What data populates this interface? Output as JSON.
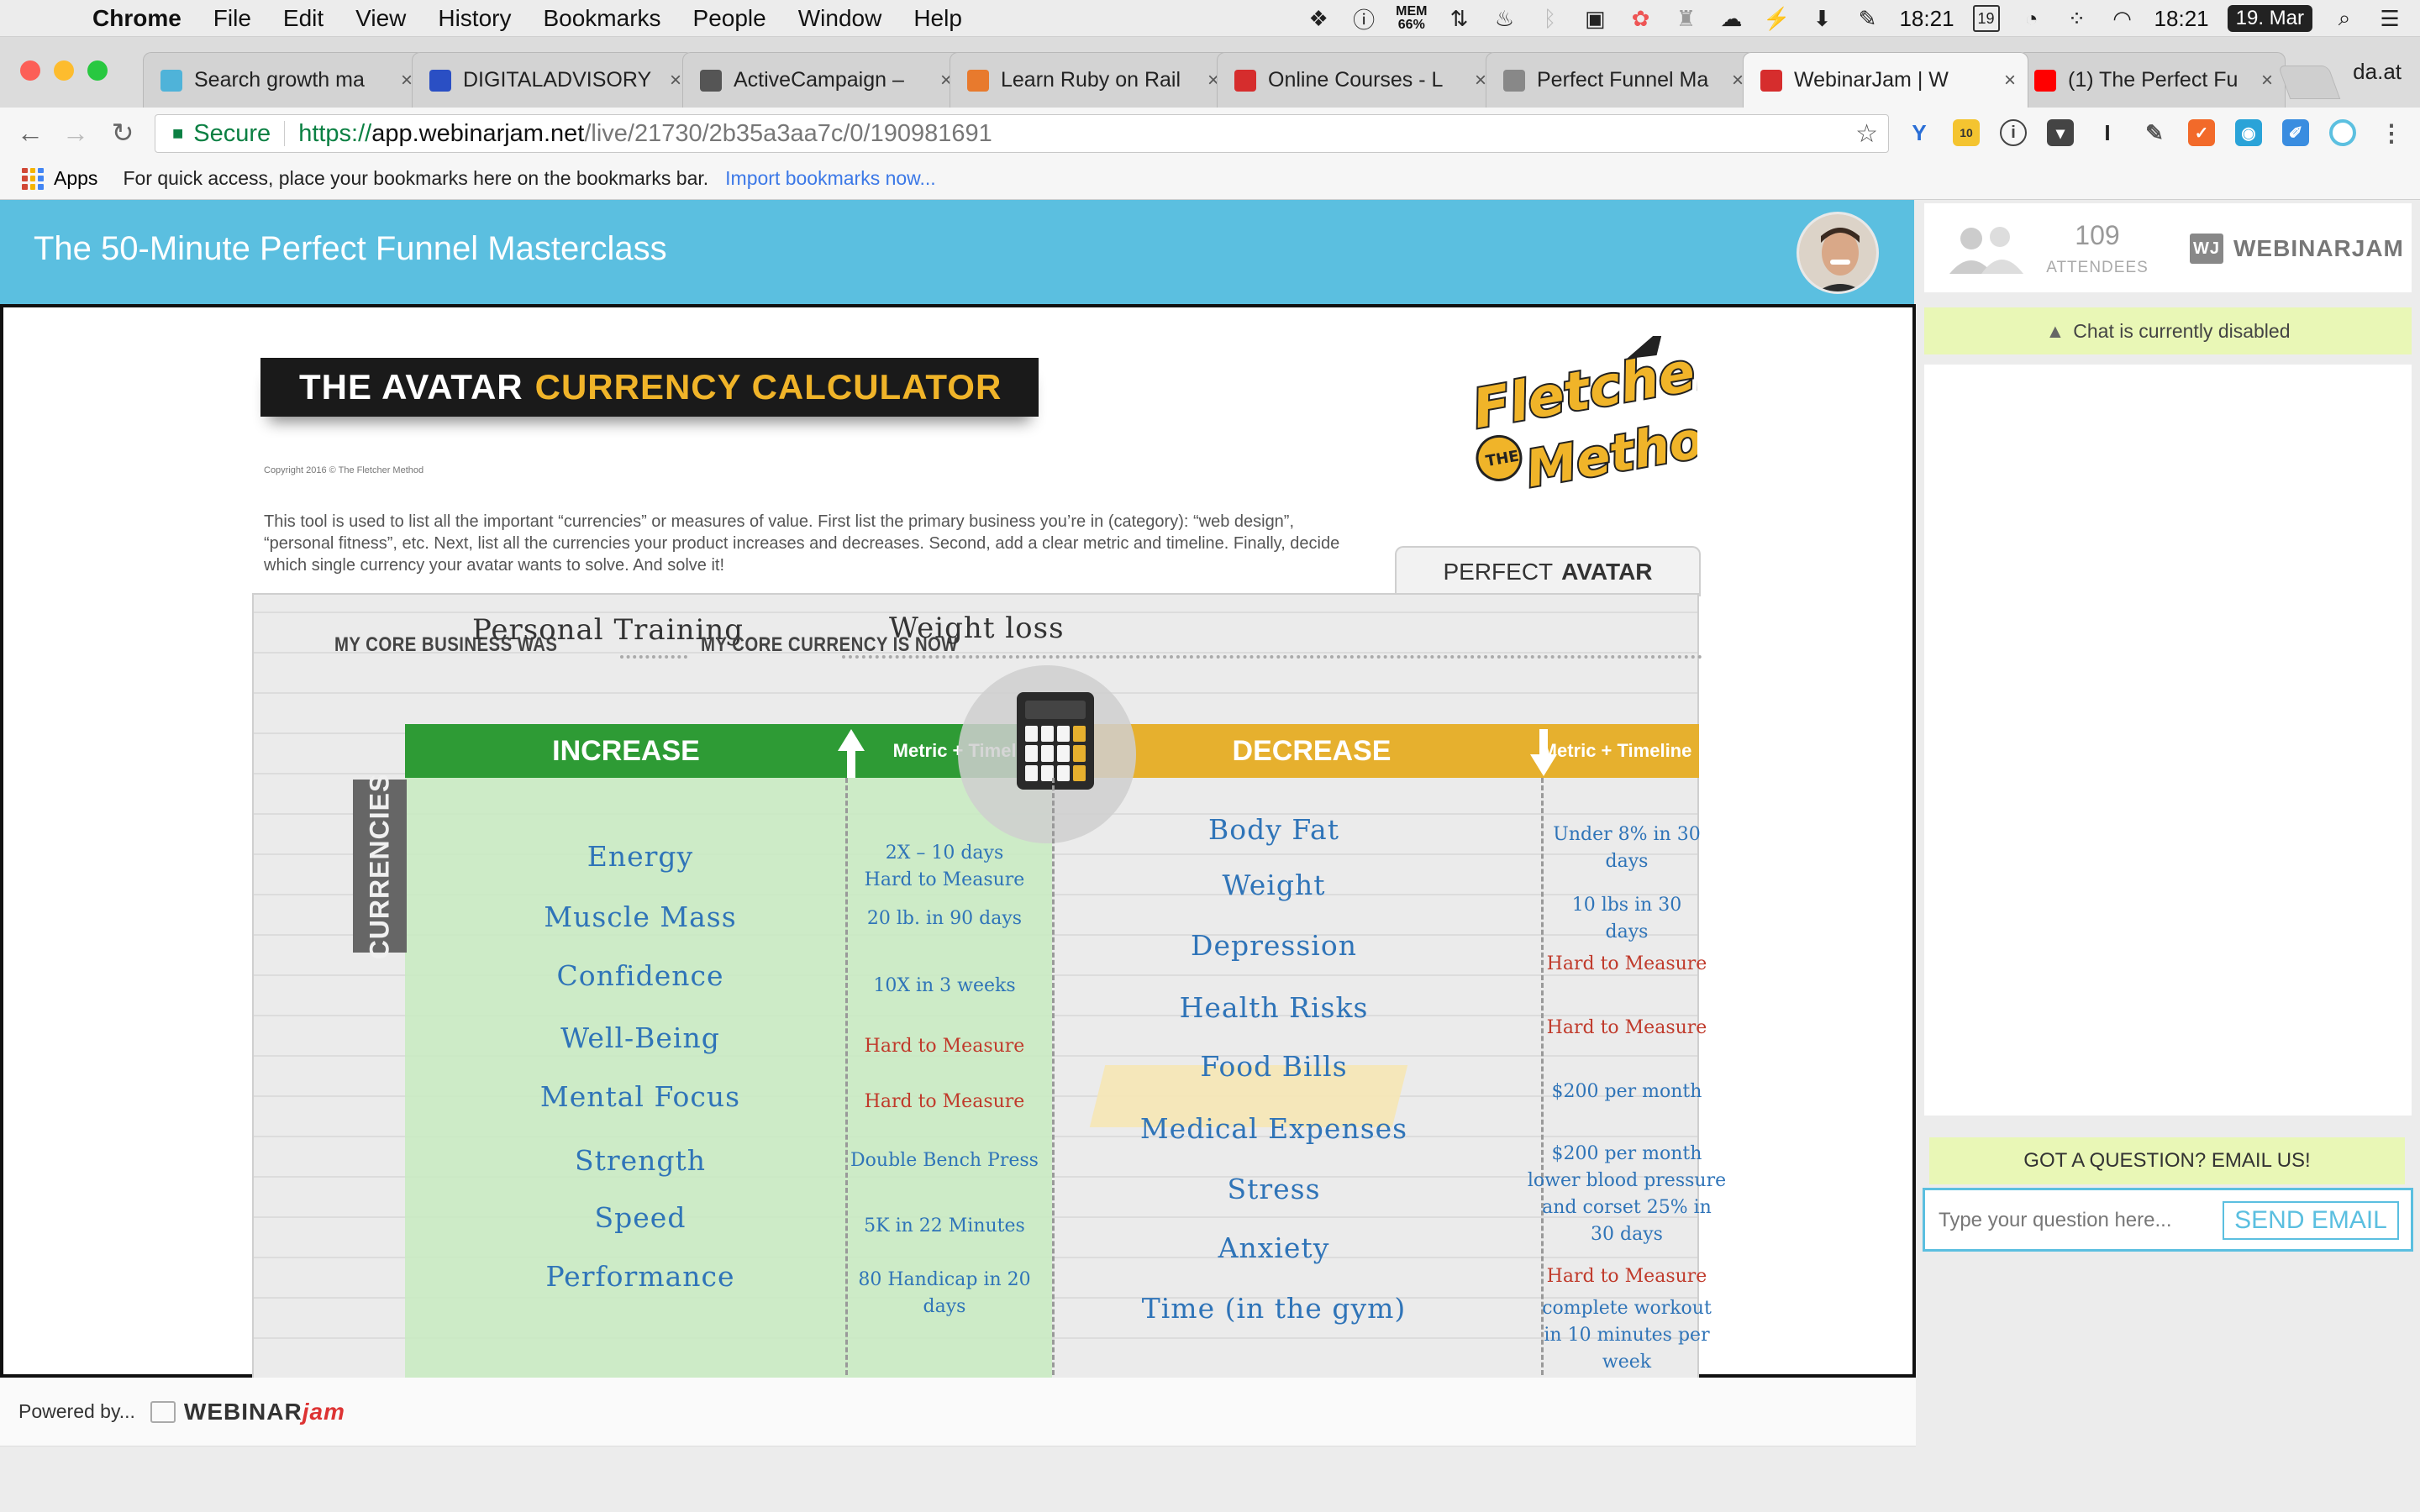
{
  "menubar": {
    "app": "Chrome",
    "items": [
      "File",
      "Edit",
      "View",
      "History",
      "Bookmarks",
      "People",
      "Window",
      "Help"
    ],
    "mem_label": "MEM",
    "mem_value": "66%",
    "calendar_day": "19",
    "time1": "18:21",
    "time2": "18:21",
    "date": "19. Mar"
  },
  "tabs": [
    {
      "title": "Search growth ma",
      "favicon_color": "#4fb3d9"
    },
    {
      "title": "DIGITALADVISORY",
      "favicon_color": "#2a4fc4"
    },
    {
      "title": "ActiveCampaign –",
      "favicon_color": "#555555"
    },
    {
      "title": "Learn Ruby on Rail",
      "favicon_color": "#e87a2d"
    },
    {
      "title": "Online Courses - L",
      "favicon_color": "#d62d2d"
    },
    {
      "title": "Perfect Funnel Ma",
      "favicon_color": "#888888"
    },
    {
      "title": "WebinarJam | W",
      "favicon_color": "#d62d2d",
      "active": true
    },
    {
      "title": "(1) The Perfect Fu",
      "favicon_color": "#ff0000"
    }
  ],
  "profile_name": "da.at",
  "omnibox": {
    "secure": "Secure",
    "proto": "https://",
    "host": "app.webinarjam.net",
    "path": "/live/21730/2b35a3aa7c/0/190981691"
  },
  "bookmarks": {
    "apps": "Apps",
    "message": "For quick access, place your bookmarks here on the bookmarks bar.",
    "import": "Import bookmarks now..."
  },
  "webinar": {
    "title": "The 50-Minute Perfect Funnel Masterclass",
    "powered_by": "Powered by...",
    "brand_a": "WEBINAR",
    "brand_b": "jam"
  },
  "slide": {
    "banner_a": "THE AVATAR",
    "banner_b": "CURRENCY CALCULATOR",
    "copyright": "Copyright 2016   ©     The Fletcher Method",
    "intro": "This tool is used to list all the important “currencies” or measures of value. First list the primary business you’re in (category): “web design”, “personal fitness”, etc. Next, list all the currencies your product increases and decreases. Second, add a clear metric and timeline. Finally, decide which single currency your avatar wants to solve. And solve it!",
    "logo_text_1": "Fletcher",
    "logo_text_2": "THE",
    "logo_text_3": "Method",
    "perfect_a": "PERFECT",
    "perfect_b": "AVATAR",
    "core_business_label": "MY CORE BUSINESS WAS",
    "core_business_value": "Personal Training",
    "core_currency_label": "MY CORE CURRENCY IS NOW",
    "core_currency_value": "Weight loss",
    "increase_label": "INCREASE",
    "decrease_label": "DECREASE",
    "metric_label": "Metric + Timeline",
    "currencies_label": "CURRENCIES",
    "increase_items": [
      "Energy",
      "Muscle Mass",
      "Confidence",
      "Well-Being",
      "Mental Focus",
      "Strength",
      "Speed",
      "Performance"
    ],
    "increase_metrics": [
      {
        "text": "2X – 10 days\nHard to Measure",
        "red": false
      },
      {
        "text": "20 lb. in 90 days",
        "red": false
      },
      {
        "text": "10X in 3 weeks",
        "red": false
      },
      {
        "text": "Hard to Measure",
        "red": true
      },
      {
        "text": "Hard to Measure",
        "red": true
      },
      {
        "text": "Double Bench Press",
        "red": false
      },
      {
        "text": "5K in 22 Minutes",
        "red": false
      },
      {
        "text": "80 Handicap in 20\ndays",
        "red": false
      }
    ],
    "decrease_items": [
      "Body Fat",
      "Weight",
      "Depression",
      "Health Risks",
      "Food Bills",
      "Medical Expenses",
      "Stress",
      "Anxiety",
      "Time (in the gym)"
    ],
    "decrease_metrics": [
      {
        "text": "Under 8% in 30\ndays",
        "red": false
      },
      {
        "text": "10 lbs in 30\ndays",
        "red": false
      },
      {
        "text": "Hard to Measure",
        "red": true
      },
      {
        "text": "Hard to Measure",
        "red": true
      },
      {
        "text": "$200 per month",
        "red": false
      },
      {
        "text": "$200 per month\nlower blood pressure\nand corset 25% in\n30 days",
        "red": false
      },
      {
        "text": "Hard to Measure",
        "red": true
      },
      {
        "text": "complete workout\nin 10 minutes per\nweek",
        "red": false
      }
    ]
  },
  "sidebar": {
    "attendees_count": "109",
    "attendees_label": "ATTENDEES",
    "brand": "WEBINARJAM",
    "brand_mark": "WJ",
    "chat_status": "Chat is currently disabled",
    "question_title": "GOT A QUESTION? EMAIL US!",
    "question_placeholder": "Type your question here...",
    "send_label": "SEND EMAIL"
  },
  "colors": {
    "header_blue": "#5bbfe0",
    "increase_green": "#2e9b35",
    "decrease_gold": "#e6b02e",
    "handwriting_blue": "#2f74b8",
    "handwriting_red": "#c03a2b",
    "notice_yellow": "#e9f7b6"
  }
}
